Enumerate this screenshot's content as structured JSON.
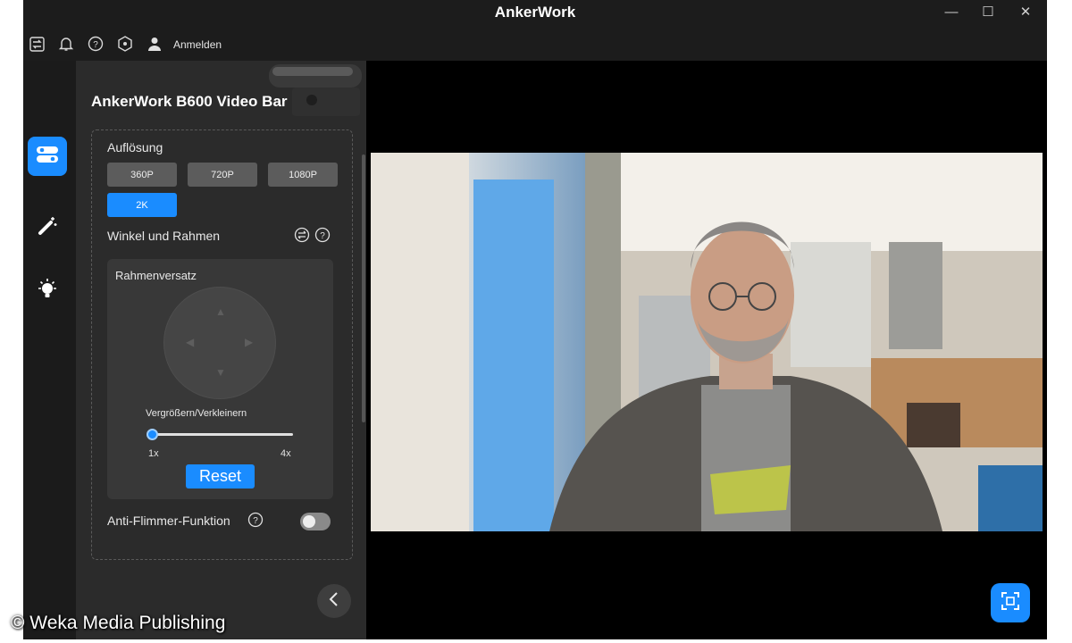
{
  "app": {
    "title": "AnkerWork"
  },
  "window_controls": {
    "minimize": "—",
    "maximize": "☐",
    "close": "✕"
  },
  "toolbar": {
    "login_label": "Anmelden"
  },
  "icons": {
    "toolbar": [
      "switch-icon",
      "bell-icon",
      "help-icon",
      "hexagon-icon",
      "user-icon"
    ],
    "rail": [
      "settings-toggle-icon",
      "magic-wand-icon",
      "lightbulb-icon"
    ]
  },
  "colors": {
    "accent": "#1a8cff",
    "panel": "#2b2b2b",
    "window": "#1c1c1c"
  },
  "device": {
    "name": "AnkerWork B600 Video Bar"
  },
  "settings": {
    "resolution_label": "Auflösung",
    "resolutions": [
      "360P",
      "720P",
      "1080P",
      "2K"
    ],
    "selected_resolution": "2K",
    "angle_label": "Winkel und Rahmen",
    "frame_offset_label": "Rahmenversatz",
    "zoom_label": "Vergrößern/Verkleinern",
    "zoom_min": "1x",
    "zoom_max": "4x",
    "zoom_value": 0,
    "reset_label": "Reset",
    "flicker_label": "Anti-Flimmer-Funktion",
    "flicker_enabled": false
  },
  "watermark": "© Weka Media Publishing"
}
